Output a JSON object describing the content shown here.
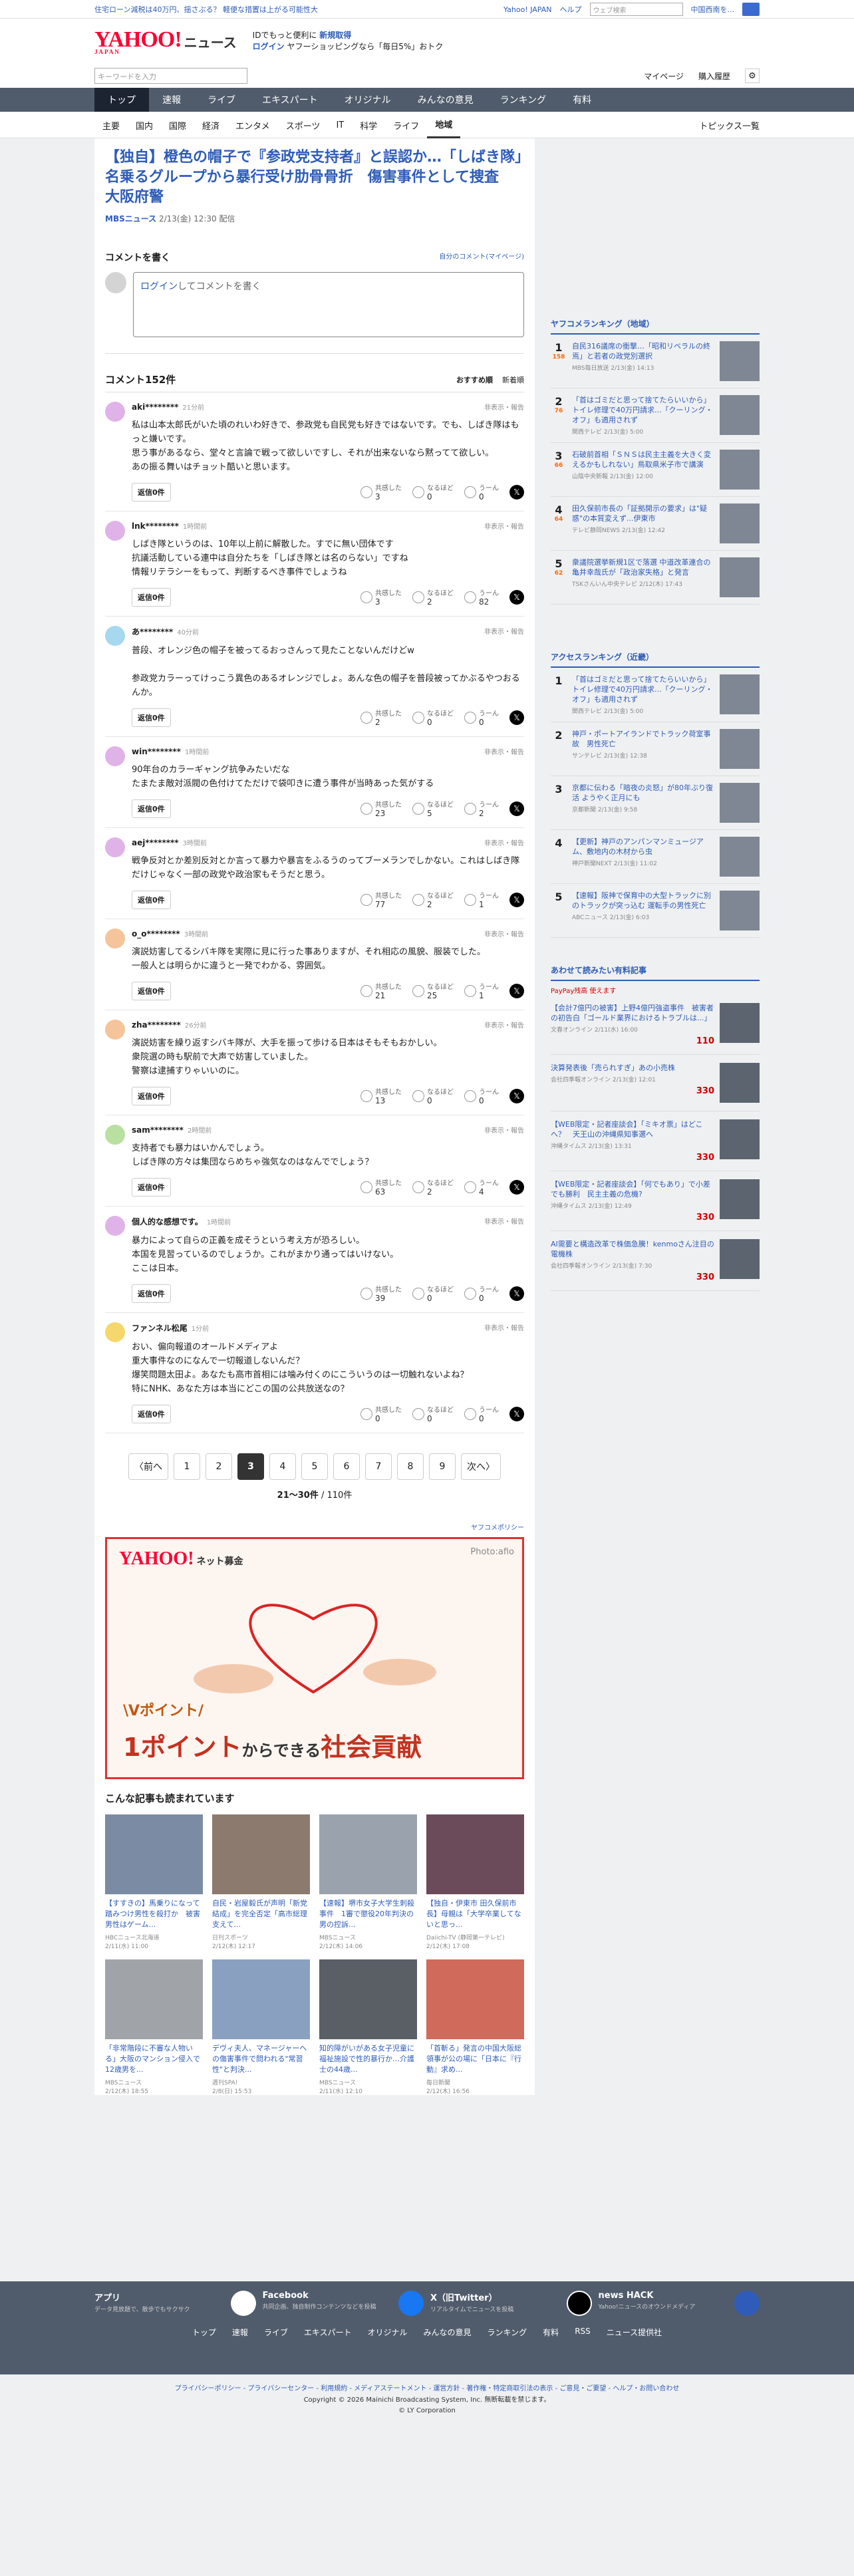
{
  "topstrip": {
    "promo": "住宅ローン減税は40万円、揺さぶる？ 軽便な措置は上がる可能性大",
    "yahoo_japan": "Yahoo! JAPAN",
    "help": "ヘルプ",
    "search_placeholder": "ウェブ検索",
    "city": "中国西南を..."
  },
  "brand": {
    "logo": "YAHOO!",
    "logo_sub": "JAPAN",
    "section": "ニュース",
    "promo1": "IDでもっと便利に",
    "promo1b": "新規取得",
    "promo2": "ログイン",
    "promo2b": "ヤフーショッピングなら「毎日5%」おトク"
  },
  "search": {
    "placeholder": "キーワードを入力",
    "mypage": "マイページ",
    "history": "購入履歴"
  },
  "gnav": [
    "トップ",
    "速報",
    "ライブ",
    "エキスパート",
    "オリジナル",
    "みんなの意見",
    "ランキング",
    "有料"
  ],
  "subnav": [
    "主要",
    "国内",
    "国際",
    "経済",
    "エンタメ",
    "スポーツ",
    "IT",
    "科学",
    "ライフ",
    "地域"
  ],
  "topics": "トピックス一覧",
  "article": {
    "title": "【独自】橙色の帽子で『参政党支持者』と誤認か…「しばき隊」名乗るグループから暴行受け肋骨骨折　傷害事件として捜査　大阪府警",
    "source": "MBSニュース",
    "date": "2/13(金) 12:30 配信"
  },
  "comment_form": {
    "heading": "コメントを書く",
    "my_comments": "自分のコメント(マイページ)",
    "login_link": "ログイン",
    "prompt": "してコメントを書く"
  },
  "comments": {
    "count_label": "コメント152件",
    "sort_rec": "おすすめ順",
    "sort_new": "新着順",
    "reply": "返信0件",
    "report": "非表示・報告",
    "r1": "共感した",
    "r2": "なるほど",
    "r3": "うーん",
    "items": [
      {
        "user": "aki********",
        "time": "21分前",
        "text": "私は山本太郎氏がいた頃のれいわ好きで、参政党も自民党も好きではないです。でも、しばき隊はもっと嫌いです。\n思う事があるなら、堂々と言論で戦って欲しいですし、それが出来ないなら黙ってて欲しい。\nあの振る舞いはチョット酷いと思います。",
        "a": "3",
        "b": "0",
        "c": "0",
        "color": "#e0b3e8"
      },
      {
        "user": "lnk********",
        "time": "1時間前",
        "text": "しばき隊というのは、10年以上前に解散した。すでに無い団体です\n抗議活動している連中は自分たちを「しばき隊とは名のらない」ですね\n情報リテラシーをもって、判断するべき事件でしょうね",
        "a": "3",
        "b": "2",
        "c": "82",
        "color": "#e0b3e8"
      },
      {
        "user": "あ********",
        "time": "40分前",
        "text": "普段、オレンジ色の帽子を被ってるおっさんって見たことないんだけどw\n\n参政党カラーってけっこう異色のあるオレンジでしょ。あんな色の帽子を普段被ってかぶるやつおるんか。",
        "a": "2",
        "b": "0",
        "c": "0",
        "color": "#a6d8f0"
      },
      {
        "user": "win********",
        "time": "1時間前",
        "text": "90年台のカラーギャング抗争みたいだな\nたまたま敵対派閥の色付けてただけで袋叩きに遭う事件が当時あった気がする",
        "a": "23",
        "b": "5",
        "c": "2",
        "color": "#e0b3e8"
      },
      {
        "user": "aej********",
        "time": "3時間前",
        "text": "戦争反対とか差別反対とか言って暴力や暴言をふるうのってブーメランでしかない。これはしばき隊だけじゃなく一部の政党や政治家もそうだと思う。",
        "a": "77",
        "c": "1",
        "b": "2",
        "color": "#e0b3e8"
      },
      {
        "user": "o_o********",
        "time": "3時間前",
        "text": "演説妨害してるシバキ隊を実際に見に行った事ありますが、それ相応の風貌、服装でした。\n一般人とは明らかに違うと一発でわかる、雰囲気。",
        "a": "21",
        "b": "25",
        "c": "1",
        "color": "#f5c49a"
      },
      {
        "user": "zha********",
        "time": "26分前",
        "text": "演説妨害を繰り返すシバキ隊が、大手を振って歩ける日本はそもそもおかしい。\n衆院選の時も駅前で大声で妨害していました。\n警察は逮捕すりゃいいのに。",
        "a": "13",
        "b": "0",
        "c": "0",
        "color": "#f5c49a"
      },
      {
        "user": "sam********",
        "time": "2時間前",
        "text": "支持者でも暴力はいかんでしょう。\nしばき隊の方々は集団ならめちゃ強気なのはなんででしょう？",
        "a": "63",
        "b": "2",
        "c": "4",
        "color": "#b8e0a0"
      },
      {
        "user": "個人的な感想です。",
        "time": "1時間前",
        "text": "暴力によって自らの正義を成そうという考え方が恐ろしい。\n本国を見習っているのでしょうか。これがまかり通ってはいけない。\nここは日本。",
        "a": "39",
        "b": "0",
        "c": "0",
        "color": "#e0b3e8"
      },
      {
        "user": "ファンネル松尾",
        "time": "1分前",
        "text": "おい、偏向報道のオールドメディアよ\n重大事件なのになんで一切報道しないんだ？\n爆笑問題太田よ。あなたも高市首相には噛み付くのにこういうのは一切触れないよね？\n特にNHK、あなた方は本当にどこの国の公共放送なの？",
        "a": "0",
        "b": "0",
        "c": "0",
        "color": "#f5d76e"
      }
    ]
  },
  "pager": {
    "prev": "〈前へ",
    "next": "次へ〉",
    "pages": [
      "1",
      "2",
      "3",
      "4",
      "5",
      "6",
      "7",
      "8",
      "9"
    ],
    "current": "3",
    "info": "21〜30件",
    "total": "/ 110件"
  },
  "ad": {
    "label": "ヤフコメポリシー",
    "logo": "YAHOO!",
    "logo_sub": "ネット募金",
    "photo": "Photo:afio",
    "copy1": "\\Vポイント/",
    "copy2a": "1ポイント",
    "copy2b": "からできる",
    "copy2c": "社会貢献"
  },
  "read": {
    "heading": "こんな記事も読まれています",
    "items": [
      {
        "title": "【すすきの】馬乗りになって踏みつけ男性を殺打か　被害男性はゲーム...",
        "src": "HBCニュース北海道",
        "date": "2/11(水) 11:00"
      },
      {
        "title": "自民・岩屋毅氏が声明「新党結成」を完全否定「高市総理支えて...",
        "src": "日刊スポーツ",
        "date": "2/12(木) 12:17"
      },
      {
        "title": "【速報】堺市女子大学生刺殺事件　1審で懲役20年判決の男の控訴...",
        "src": "MBSニュース",
        "date": "2/12(木) 14:06"
      },
      {
        "title": "【独自・伊東市 田久保前市長】母親は「大学卒業してないと思っ...",
        "src": "Daiichi-TV (静岡第一テレビ)",
        "date": "2/12(木) 17:08"
      },
      {
        "title": "「非常階段に不審な人物いる」大阪のマンション侵入で12歳男を...",
        "src": "MBSニュース",
        "date": "2/12(木) 18:55"
      },
      {
        "title": "デヴィ夫人、マネージャーへの傷害事件で問われる\"常習性\"と判決...",
        "src": "週刊SPA!",
        "date": "2/8(日) 15:53"
      },
      {
        "title": "知的障がいがある女子児童に福祉施設で性的暴行か…介護士の44歳...",
        "src": "MBSニュース",
        "date": "2/11(水) 12:10"
      },
      {
        "title": "「首斬る」発言の中国大阪総領事が公の場に「日本に『行動』求め...",
        "src": "毎日新聞",
        "date": "2/12(木) 16:56"
      }
    ]
  },
  "ranking": {
    "heading": "ヤフコメランキング（地域）",
    "items": [
      {
        "n": "1",
        "cnt": "158",
        "title": "自民316議席の衝撃…「昭和リベラルの終焉」と若者の政党別選択",
        "src": "MBS毎日放送 2/13(金) 14:13"
      },
      {
        "n": "2",
        "cnt": "76",
        "title": "「首はゴミだと思って捨てたらいいから」トイレ修理で40万円請求...「クーリング・オフ」も適用されず",
        "src": "関西テレビ 2/13(金) 5:00"
      },
      {
        "n": "3",
        "cnt": "66",
        "title": "石破前首相「ＳＮＳは民主主義を大きく変えるかもしれない」鳥取県米子市で講演",
        "src": "山陰中央新報 2/13(金) 12:00"
      },
      {
        "n": "4",
        "cnt": "64",
        "title": "田久保前市長の「証拠開示の要求」は\"疑惑\"の本質変えず...伊東市",
        "src": "テレビ静岡NEWS 2/13(金) 12:42"
      },
      {
        "n": "5",
        "cnt": "62",
        "title": "衆議院選挙新規1区で落選 中道改革連合の亀井幸哉氏が「政治家失格」と発言",
        "src": "TSKさんいん中央テレビ 2/12(木) 17:43"
      }
    ]
  },
  "access": {
    "heading": "アクセスランキング（近畿）",
    "items": [
      {
        "n": "1",
        "title": "「首はゴミだと思って捨てたらいいから」トイレ修理で40万円請求...「クーリング・オフ」も適用されず",
        "src": "関西テレビ 2/13(金) 5:00"
      },
      {
        "n": "2",
        "title": "神戸・ポートアイランドでトラック荷室事故　男性死亡",
        "src": "サンテレビ 2/13(金) 12:38"
      },
      {
        "n": "3",
        "title": "京都に伝わる「暗夜の炎怒」が80年ぶり復活 ようやく正月にも",
        "src": "京都新聞 2/13(金) 9:58"
      },
      {
        "n": "4",
        "title": "【更新】神戸のアンパンマンミュージアム、敷地内の木材から虫",
        "src": "神戸新聞NEXT 2/13(金) 11:02"
      },
      {
        "n": "5",
        "title": "【速報】阪神で保育中の大型トラックに別のトラックが突っ込む 運転手の男性死亡",
        "src": "ABCニュース 2/13(金) 6:03"
      }
    ]
  },
  "shop": {
    "heading": "あわせて読みたい有料記事",
    "paypay": "PayPay残高 使えます",
    "items": [
      {
        "title": "【会計7億円の被害】上野4億円強盗事件　被害者の初告白「ゴールド業界におけるトラブルは...」",
        "src": "文春オンライン 2/11(水) 16:00",
        "price": "110"
      },
      {
        "title": "決算発表後「売られすぎ」あの小売株",
        "src": "会社四季報オンライン 2/13(金) 12:01",
        "price": "330"
      },
      {
        "title": "【WEB限定・記者座談会】「ミキオ票」はどこへ？　天王山の沖縄県知事選へ",
        "src": "沖縄タイムス 2/13(金) 13:31",
        "price": "330"
      },
      {
        "title": "【WEB限定・記者座談会】「何でもあり」で小差でも勝利　民主主義の危機?",
        "src": "沖縄タイムス 2/13(金) 12:49",
        "price": "330"
      },
      {
        "title": "AI需要と構造改革で株価急騰！kenmoさん注目の電機株",
        "src": "会社四季報オンライン 2/13(金) 7:30",
        "price": "330"
      }
    ]
  },
  "footer": {
    "apps": [
      {
        "t": "アプリ",
        "d": "データ見放題で、散歩でもサクサク"
      },
      {
        "t": "Facebook",
        "d": "共同企画、独自制作コンテンツなどを投稿"
      },
      {
        "t": "X（旧Twitter）",
        "d": "リアルタイムでニュースを投稿"
      },
      {
        "t": "news HACK",
        "d": "Yahoo!ニュースのオウンドメディア"
      }
    ],
    "links": [
      "トップ",
      "速報",
      "ライブ",
      "エキスパート",
      "オリジナル",
      "みんなの意見",
      "ランキング",
      "有料",
      "RSS",
      "ニュース提供社"
    ],
    "legal": "プライバシーポリシー - プライバシーセンター - 利用規約 - メディアステートメント - 運営方針 - 著作権・特定商取引法の表示 - ご意見・ご要望 - ヘルプ・お問い合わせ",
    "copy1": "Copyright © 2026 Mainichi Broadcasting System, Inc. 無断転載を禁じます。",
    "copy2": "© LY Corporation"
  }
}
